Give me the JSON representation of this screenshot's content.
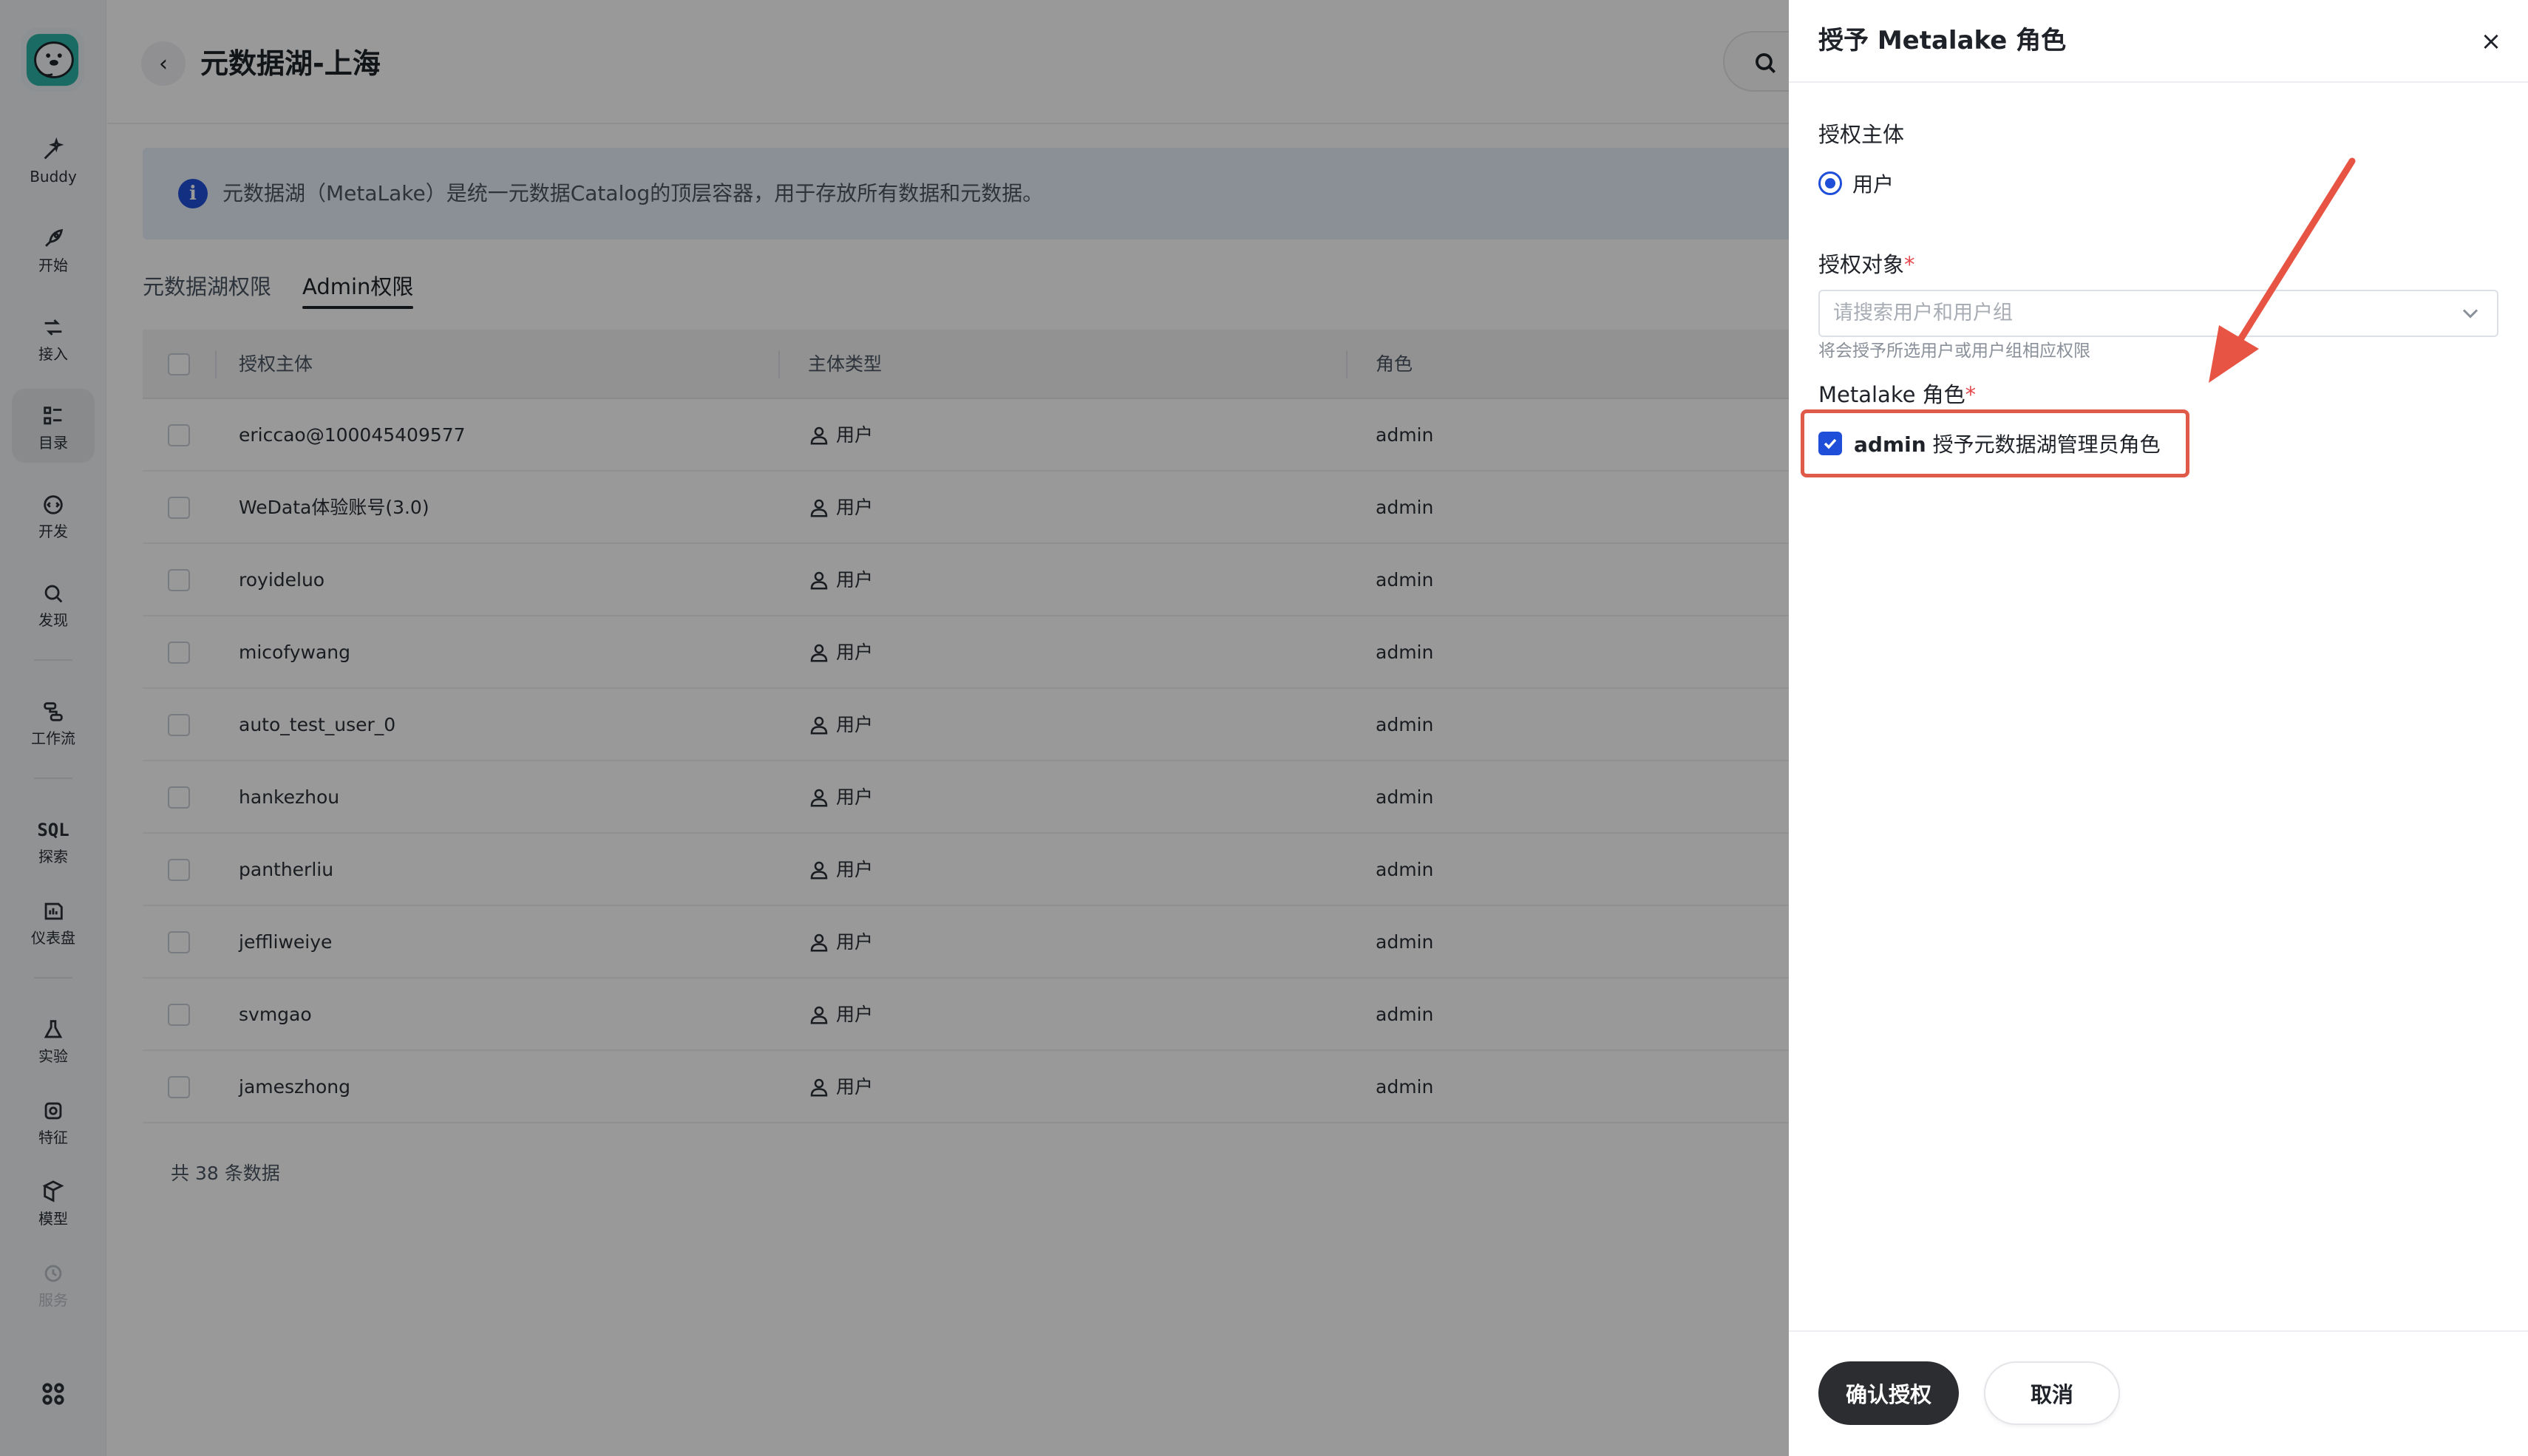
{
  "sidebar": {
    "items": [
      {
        "label": "Buddy",
        "icon": "wand-icon"
      },
      {
        "label": "开始",
        "icon": "rocket-icon"
      },
      {
        "label": "接入",
        "icon": "connect-icon"
      },
      {
        "label": "目录",
        "icon": "catalog-icon"
      },
      {
        "label": "开发",
        "icon": "develop-icon"
      },
      {
        "label": "发现",
        "icon": "search-icon"
      },
      {
        "label": "工作流",
        "icon": "workflow-icon"
      },
      {
        "label": "探索",
        "icon_text": "SQL"
      },
      {
        "label": "仪表盘",
        "icon": "dashboard-icon"
      },
      {
        "label": "实验",
        "icon": "experiment-icon"
      },
      {
        "label": "特征",
        "icon": "feature-icon"
      },
      {
        "label": "模型",
        "icon": "model-icon"
      },
      {
        "label": "服务",
        "icon": "service-icon"
      }
    ]
  },
  "header": {
    "title": "元数据湖-上海",
    "back_glyph": "‹"
  },
  "banner": {
    "text": "元数据湖（MetaLake）是统一元数据Catalog的顶层容器，用于存放所有数据和元数据。"
  },
  "tabs": [
    {
      "label": "元数据湖权限",
      "active": false
    },
    {
      "label": "Admin权限",
      "active": true
    }
  ],
  "table": {
    "columns": [
      "授权主体",
      "主体类型",
      "角色"
    ],
    "rows": [
      {
        "principal": "ericcao@100045409577",
        "type": "用户",
        "role": "admin"
      },
      {
        "principal": "WeData体验账号(3.0)",
        "type": "用户",
        "role": "admin"
      },
      {
        "principal": "royideluo",
        "type": "用户",
        "role": "admin"
      },
      {
        "principal": "micofywang",
        "type": "用户",
        "role": "admin"
      },
      {
        "principal": "auto_test_user_0",
        "type": "用户",
        "role": "admin"
      },
      {
        "principal": "hankezhou",
        "type": "用户",
        "role": "admin"
      },
      {
        "principal": "pantherliu",
        "type": "用户",
        "role": "admin"
      },
      {
        "principal": "jeffliweiye",
        "type": "用户",
        "role": "admin"
      },
      {
        "principal": "svmgao",
        "type": "用户",
        "role": "admin"
      },
      {
        "principal": "jameszhong",
        "type": "用户",
        "role": "admin"
      }
    ],
    "total": "共 38 条数据"
  },
  "drawer": {
    "title": "授予 Metalake 角色",
    "close_glyph": "×",
    "principal_label": "授权主体",
    "principal_option": "用户",
    "target_label": "授权对象",
    "required_mark": "*",
    "target_placeholder": "请搜索用户和用户组",
    "target_hint": "将会授予所选用户或用户组相应权限",
    "role_label": "Metalake 角色",
    "role_option_name": "admin",
    "role_option_desc": "授予元数据湖管理员角色",
    "confirm_label": "确认授权",
    "cancel_label": "取消"
  },
  "colors": {
    "accent": "#1f4fd8",
    "highlight": "#e05a4a",
    "primary_button": "#2c2d30"
  }
}
